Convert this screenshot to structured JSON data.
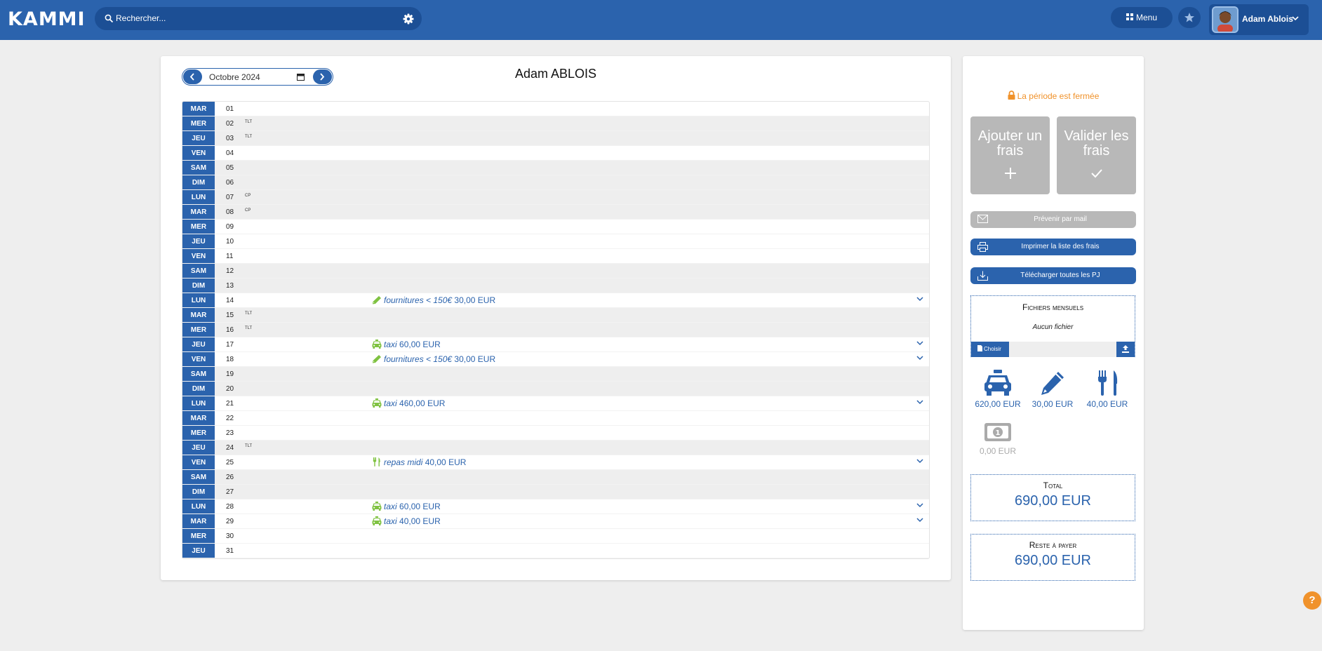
{
  "app": {
    "logo": "KAMMI"
  },
  "search": {
    "placeholder": "Rechercher..."
  },
  "header": {
    "menu_label": "Menu",
    "user_name": "Adam Ablois"
  },
  "calendar": {
    "month": "Octobre 2024",
    "person": "Adam ABLOIS",
    "days": [
      {
        "dn": "MAR",
        "d": "01",
        "tag": "",
        "grey": false,
        "exp": null
      },
      {
        "dn": "MER",
        "d": "02",
        "tag": "TLT",
        "grey": true,
        "exp": null
      },
      {
        "dn": "JEU",
        "d": "03",
        "tag": "TLT",
        "grey": true,
        "exp": null
      },
      {
        "dn": "VEN",
        "d": "04",
        "tag": "",
        "grey": false,
        "exp": null
      },
      {
        "dn": "SAM",
        "d": "05",
        "tag": "",
        "grey": true,
        "exp": null
      },
      {
        "dn": "DIM",
        "d": "06",
        "tag": "",
        "grey": true,
        "exp": null
      },
      {
        "dn": "LUN",
        "d": "07",
        "tag": "CP",
        "grey": true,
        "exp": null
      },
      {
        "dn": "MAR",
        "d": "08",
        "tag": "CP",
        "grey": true,
        "exp": null
      },
      {
        "dn": "MER",
        "d": "09",
        "tag": "",
        "grey": false,
        "exp": null
      },
      {
        "dn": "JEU",
        "d": "10",
        "tag": "",
        "grey": false,
        "exp": null
      },
      {
        "dn": "VEN",
        "d": "11",
        "tag": "",
        "grey": false,
        "exp": null
      },
      {
        "dn": "SAM",
        "d": "12",
        "tag": "",
        "grey": true,
        "exp": null
      },
      {
        "dn": "DIM",
        "d": "13",
        "tag": "",
        "grey": true,
        "exp": null
      },
      {
        "dn": "LUN",
        "d": "14",
        "tag": "",
        "grey": false,
        "exp": {
          "icon": "pencil",
          "name": "fournitures < 150€",
          "amount": "30,00 EUR"
        }
      },
      {
        "dn": "MAR",
        "d": "15",
        "tag": "TLT",
        "grey": true,
        "exp": null
      },
      {
        "dn": "MER",
        "d": "16",
        "tag": "TLT",
        "grey": true,
        "exp": null
      },
      {
        "dn": "JEU",
        "d": "17",
        "tag": "",
        "grey": false,
        "exp": {
          "icon": "taxi",
          "name": "taxi",
          "amount": "60,00 EUR"
        }
      },
      {
        "dn": "VEN",
        "d": "18",
        "tag": "",
        "grey": false,
        "exp": {
          "icon": "pencil",
          "name": "fournitures < 150€",
          "amount": "30,00 EUR"
        }
      },
      {
        "dn": "SAM",
        "d": "19",
        "tag": "",
        "grey": true,
        "exp": null
      },
      {
        "dn": "DIM",
        "d": "20",
        "tag": "",
        "grey": true,
        "exp": null
      },
      {
        "dn": "LUN",
        "d": "21",
        "tag": "",
        "grey": false,
        "exp": {
          "icon": "taxi",
          "name": "taxi",
          "amount": "460,00 EUR"
        }
      },
      {
        "dn": "MAR",
        "d": "22",
        "tag": "",
        "grey": false,
        "exp": null
      },
      {
        "dn": "MER",
        "d": "23",
        "tag": "",
        "grey": false,
        "exp": null
      },
      {
        "dn": "JEU",
        "d": "24",
        "tag": "TLT",
        "grey": true,
        "exp": null
      },
      {
        "dn": "VEN",
        "d": "25",
        "tag": "",
        "grey": false,
        "exp": {
          "icon": "cutlery",
          "name": "repas midi",
          "amount": "40,00 EUR"
        }
      },
      {
        "dn": "SAM",
        "d": "26",
        "tag": "",
        "grey": true,
        "exp": null
      },
      {
        "dn": "DIM",
        "d": "27",
        "tag": "",
        "grey": true,
        "exp": null
      },
      {
        "dn": "LUN",
        "d": "28",
        "tag": "",
        "grey": false,
        "exp": {
          "icon": "taxi",
          "name": "taxi",
          "amount": "60,00 EUR"
        }
      },
      {
        "dn": "MAR",
        "d": "29",
        "tag": "",
        "grey": false,
        "exp": {
          "icon": "taxi",
          "name": "taxi",
          "amount": "40,00 EUR"
        }
      },
      {
        "dn": "MER",
        "d": "30",
        "tag": "",
        "grey": false,
        "exp": null
      },
      {
        "dn": "JEU",
        "d": "31",
        "tag": "",
        "grey": false,
        "exp": null
      }
    ]
  },
  "side": {
    "closed_text": "La période est fermée",
    "add_label": "Ajouter un frais",
    "validate_label": "Valider les frais",
    "mail_label": "Prévenir par mail",
    "print_label": "Imprimer la liste des frais",
    "download_label": "Télécharger toutes les PJ",
    "files_title": "Fichiers mensuels",
    "files_empty": "Aucun fichier",
    "choose_label": "Choisir",
    "categories": [
      {
        "icon": "taxi-icon",
        "value": "620,00 EUR"
      },
      {
        "icon": "pencil-icon",
        "value": "30,00 EUR"
      },
      {
        "icon": "cutlery-icon",
        "value": "40,00 EUR"
      },
      {
        "icon": "cash-icon",
        "value": "0,00 EUR"
      }
    ],
    "total_title": "Total",
    "total_value": "690,00 EUR",
    "rest_title": "Reste à payer",
    "rest_value": "690,00 EUR"
  },
  "help": {
    "label": "?"
  },
  "colors": {
    "primary": "#2b63ad",
    "dark": "#1c4f95",
    "accent": "#f0922b",
    "green": "#7fc241",
    "disabled": "#b8b8b8"
  }
}
